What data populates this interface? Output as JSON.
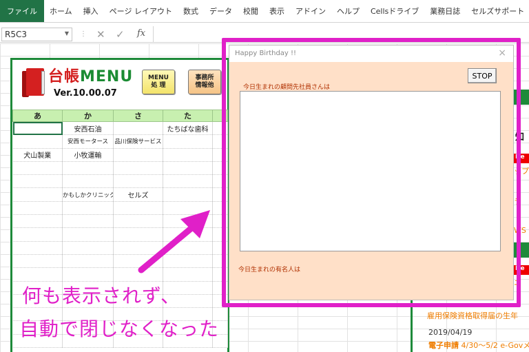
{
  "ribbon": {
    "tabs": [
      "ファイル",
      "ホーム",
      "挿入",
      "ページ レイアウト",
      "数式",
      "データ",
      "校閲",
      "表示",
      "アドイン",
      "ヘルプ",
      "Cellsドライブ",
      "業務日誌",
      "セルズサポート"
    ]
  },
  "formula_bar": {
    "name_box": "R5C3",
    "fx": "fx"
  },
  "menu": {
    "title_ja": "台帳",
    "title_en": "MENU",
    "version": "Ver.10.00.07",
    "btn_menu": "MENU\n処 理",
    "btn_office": "事務所\n情報他",
    "headers": [
      "あ",
      "か",
      "さ",
      "た"
    ],
    "rows": [
      [
        "",
        "安西石油",
        "",
        "たちばな歯科"
      ],
      [
        "",
        "安西モータース",
        "品川保険サービス",
        ""
      ],
      [
        "犬山製業",
        "小牧運輸",
        "",
        ""
      ],
      [
        "",
        "",
        "",
        ""
      ],
      [
        "",
        "",
        "",
        ""
      ],
      [
        "",
        "かもしかクリニック",
        "セルズ",
        ""
      ],
      [
        "",
        "",
        "",
        ""
      ],
      [
        "",
        "",
        "",
        ""
      ],
      [
        "",
        "",
        "",
        ""
      ],
      [
        "",
        "",
        "",
        ""
      ],
      [
        "",
        "",
        "",
        ""
      ],
      [
        "",
        "",
        "",
        ""
      ],
      [
        "",
        "",
        "",
        ""
      ],
      [
        "",
        "",
        "",
        ""
      ],
      [
        "",
        "",
        "",
        ""
      ],
      [
        "",
        "",
        "",
        ""
      ],
      [
        "",
        "",
        "",
        ""
      ]
    ]
  },
  "right_panel": {
    "new1": "Ne",
    "new2": "Ne",
    "kanji": "知",
    "orange1": "ップ",
    "orange2": "ラ",
    "orange3": "WS",
    "orange4": "ニ",
    "partial_line": "雇用保険資格取得届の生年",
    "date": "2019/04/19",
    "link_bold": "電子申請",
    "link_rest": " 4/30〜5/2 e-Govメ"
  },
  "dialog": {
    "title": "Happy Birthday !!",
    "close": "×",
    "stop": "STOP",
    "label_clients": "今日生まれの顧問先社員さんは",
    "label_famous": "今日生まれの有名人は"
  },
  "annotation": {
    "line1": "何も表示されず、",
    "line2": "自動で閉じなくなった",
    "color": "#e020c8"
  }
}
